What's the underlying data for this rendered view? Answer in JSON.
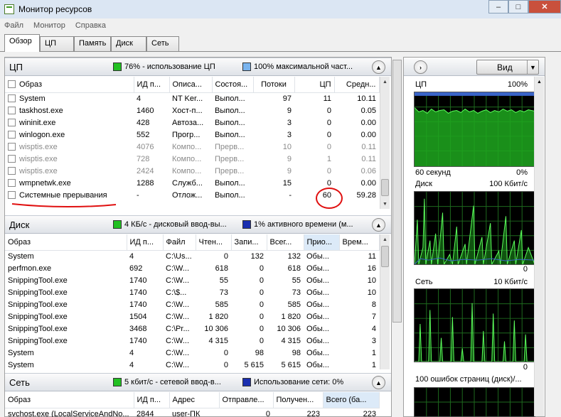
{
  "window": {
    "title": "Монитор ресурсов",
    "minimize": "–",
    "maximize": "□",
    "close": "✕"
  },
  "menu": [
    "Файл",
    "Монитор",
    "Справка"
  ],
  "tabs": [
    "Обзор",
    "ЦП",
    "Память",
    "Диск",
    "Сеть"
  ],
  "active_tab": "Обзор",
  "cpu": {
    "title": "ЦП",
    "metric1": "76% - использование ЦП",
    "metric1_color": "#22c022",
    "metric2": "100% максимальной част...",
    "metric2_color": "#7ab4ee",
    "columns": [
      "Образ",
      "ИД п...",
      "Описа...",
      "Состоя...",
      "Потоки",
      "ЦП",
      "Средн..."
    ],
    "rows": [
      {
        "image": "System",
        "pid": "4",
        "desc": "NT Ker...",
        "state": "Выпол...",
        "threads": "97",
        "cpu": "11",
        "avg": "10.11",
        "gray": false
      },
      {
        "image": "taskhost.exe",
        "pid": "1460",
        "desc": "Хост-п...",
        "state": "Выпол...",
        "threads": "9",
        "cpu": "0",
        "avg": "0.05",
        "gray": false
      },
      {
        "image": "wininit.exe",
        "pid": "428",
        "desc": "Автоза...",
        "state": "Выпол...",
        "threads": "3",
        "cpu": "0",
        "avg": "0.00",
        "gray": false
      },
      {
        "image": "winlogon.exe",
        "pid": "552",
        "desc": "Прогр...",
        "state": "Выпол...",
        "threads": "3",
        "cpu": "0",
        "avg": "0.00",
        "gray": false
      },
      {
        "image": "wisptis.exe",
        "pid": "4076",
        "desc": "Компо...",
        "state": "Прерв...",
        "threads": "10",
        "cpu": "0",
        "avg": "0.11",
        "gray": true
      },
      {
        "image": "wisptis.exe",
        "pid": "728",
        "desc": "Компо...",
        "state": "Прерв...",
        "threads": "9",
        "cpu": "1",
        "avg": "0.11",
        "gray": true
      },
      {
        "image": "wisptis.exe",
        "pid": "2424",
        "desc": "Компо...",
        "state": "Прерв...",
        "threads": "9",
        "cpu": "0",
        "avg": "0.06",
        "gray": true
      },
      {
        "image": "wmpnetwk.exe",
        "pid": "1288",
        "desc": "Служб...",
        "state": "Выпол...",
        "threads": "15",
        "cpu": "0",
        "avg": "0.00",
        "gray": false
      },
      {
        "image": "Системные прерывания",
        "pid": "-",
        "desc": "Отлож...",
        "state": "Выпол...",
        "threads": "-",
        "cpu": "60",
        "avg": "59.28",
        "gray": false
      }
    ]
  },
  "disk": {
    "title": "Диск",
    "metric1": "4 КБ/с - дисковый ввод-вы...",
    "metric1_color": "#22c022",
    "metric2": "1% активного времени (м...",
    "metric2_color": "#1a2fb0",
    "columns": [
      "Образ",
      "ИД п...",
      "Файл",
      "Чтен...",
      "Запи...",
      "Всег...",
      "Прио...",
      "Врем..."
    ],
    "rows": [
      {
        "image": "System",
        "pid": "4",
        "file": "C:\\Us...",
        "read": "0",
        "write": "132",
        "total": "132",
        "prio": "Обы...",
        "time": "11"
      },
      {
        "image": "perfmon.exe",
        "pid": "692",
        "file": "C:\\W...",
        "read": "618",
        "write": "0",
        "total": "618",
        "prio": "Обы...",
        "time": "16"
      },
      {
        "image": "SnippingTool.exe",
        "pid": "1740",
        "file": "C:\\W...",
        "read": "55",
        "write": "0",
        "total": "55",
        "prio": "Обы...",
        "time": "10"
      },
      {
        "image": "SnippingTool.exe",
        "pid": "1740",
        "file": "C:\\$...",
        "read": "73",
        "write": "0",
        "total": "73",
        "prio": "Обы...",
        "time": "10"
      },
      {
        "image": "SnippingTool.exe",
        "pid": "1740",
        "file": "C:\\W...",
        "read": "585",
        "write": "0",
        "total": "585",
        "prio": "Обы...",
        "time": "8"
      },
      {
        "image": "SnippingTool.exe",
        "pid": "1504",
        "file": "C:\\W...",
        "read": "1 820",
        "write": "0",
        "total": "1 820",
        "prio": "Обы...",
        "time": "7"
      },
      {
        "image": "SnippingTool.exe",
        "pid": "3468",
        "file": "C:\\Pr...",
        "read": "10 306",
        "write": "0",
        "total": "10 306",
        "prio": "Обы...",
        "time": "4"
      },
      {
        "image": "SnippingTool.exe",
        "pid": "1740",
        "file": "C:\\W...",
        "read": "4 315",
        "write": "0",
        "total": "4 315",
        "prio": "Обы...",
        "time": "3"
      },
      {
        "image": "System",
        "pid": "4",
        "file": "C:\\W...",
        "read": "0",
        "write": "98",
        "total": "98",
        "prio": "Обы...",
        "time": "1"
      },
      {
        "image": "System",
        "pid": "4",
        "file": "C:\\W...",
        "read": "0",
        "write": "5 615",
        "total": "5 615",
        "prio": "Обы...",
        "time": "1"
      }
    ]
  },
  "network": {
    "title": "Сеть",
    "metric1": "5 кбит/с - сетевой ввод-в...",
    "metric1_color": "#22c022",
    "metric2": "Использование сети: 0%",
    "metric2_color": "#1a2fb0",
    "columns": [
      "Образ",
      "ИД п...",
      "Адрес",
      "Отправле...",
      "Получен...",
      "Всего (ба..."
    ],
    "rows": [
      {
        "image": "svchost.exe (LocalServiceAndNo...",
        "pid": "2844",
        "address": "user-ПК",
        "sent": "0",
        "recv": "223",
        "total": "223"
      }
    ]
  },
  "right_panel": {
    "view_label": "Вид",
    "graphs": [
      {
        "name": "ЦП",
        "max": "100%",
        "min_label": "60 секунд",
        "min_value": "0%",
        "color": "#22c022"
      },
      {
        "name": "Диск",
        "max": "100 Кбит/с",
        "min_label": "",
        "min_value": "0",
        "color": "#22c022"
      },
      {
        "name": "Сеть",
        "max": "10 Кбит/с",
        "min_label": "",
        "min_value": "0",
        "color": "#22c022"
      },
      {
        "name": "100 ошибок страниц (диск)/...",
        "max": "",
        "min_label": "",
        "min_value": "",
        "color": "#22c022"
      }
    ]
  }
}
